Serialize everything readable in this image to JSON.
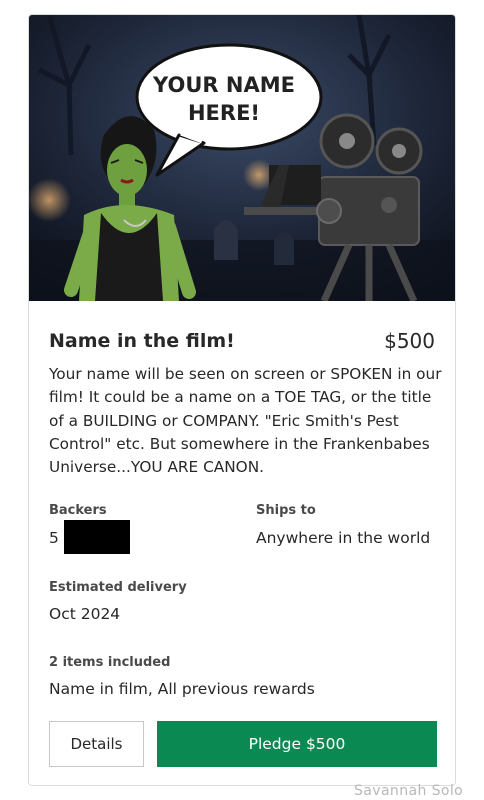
{
  "reward": {
    "image_bubble_line1": "YOUR NAME",
    "image_bubble_line2": "HERE!",
    "title": "Name in the film!",
    "price": "$500",
    "description": "Your name will be seen on screen or SPOKEN in our film! It could be a name on a TOE TAG, or the title of a BUILDING or COMPANY. \"Eric Smith's Pest Control\" etc. But somewhere in the Frankenbabes Universe...YOU ARE CANON."
  },
  "stats": {
    "backers_label": "Backers",
    "backers_value": "5",
    "ships_label": "Ships to",
    "ships_value": "Anywhere in the world",
    "delivery_label": "Estimated delivery",
    "delivery_value": "Oct 2024",
    "items_label": "2 items included",
    "items_value": "Name in film, All previous rewards"
  },
  "buttons": {
    "details_label": "Details",
    "pledge_label": "Pledge $500"
  },
  "watermark": "Savannah Solo",
  "colors": {
    "pledge_green": "#0a8a52",
    "text": "#282828",
    "redaction": "#000000"
  }
}
